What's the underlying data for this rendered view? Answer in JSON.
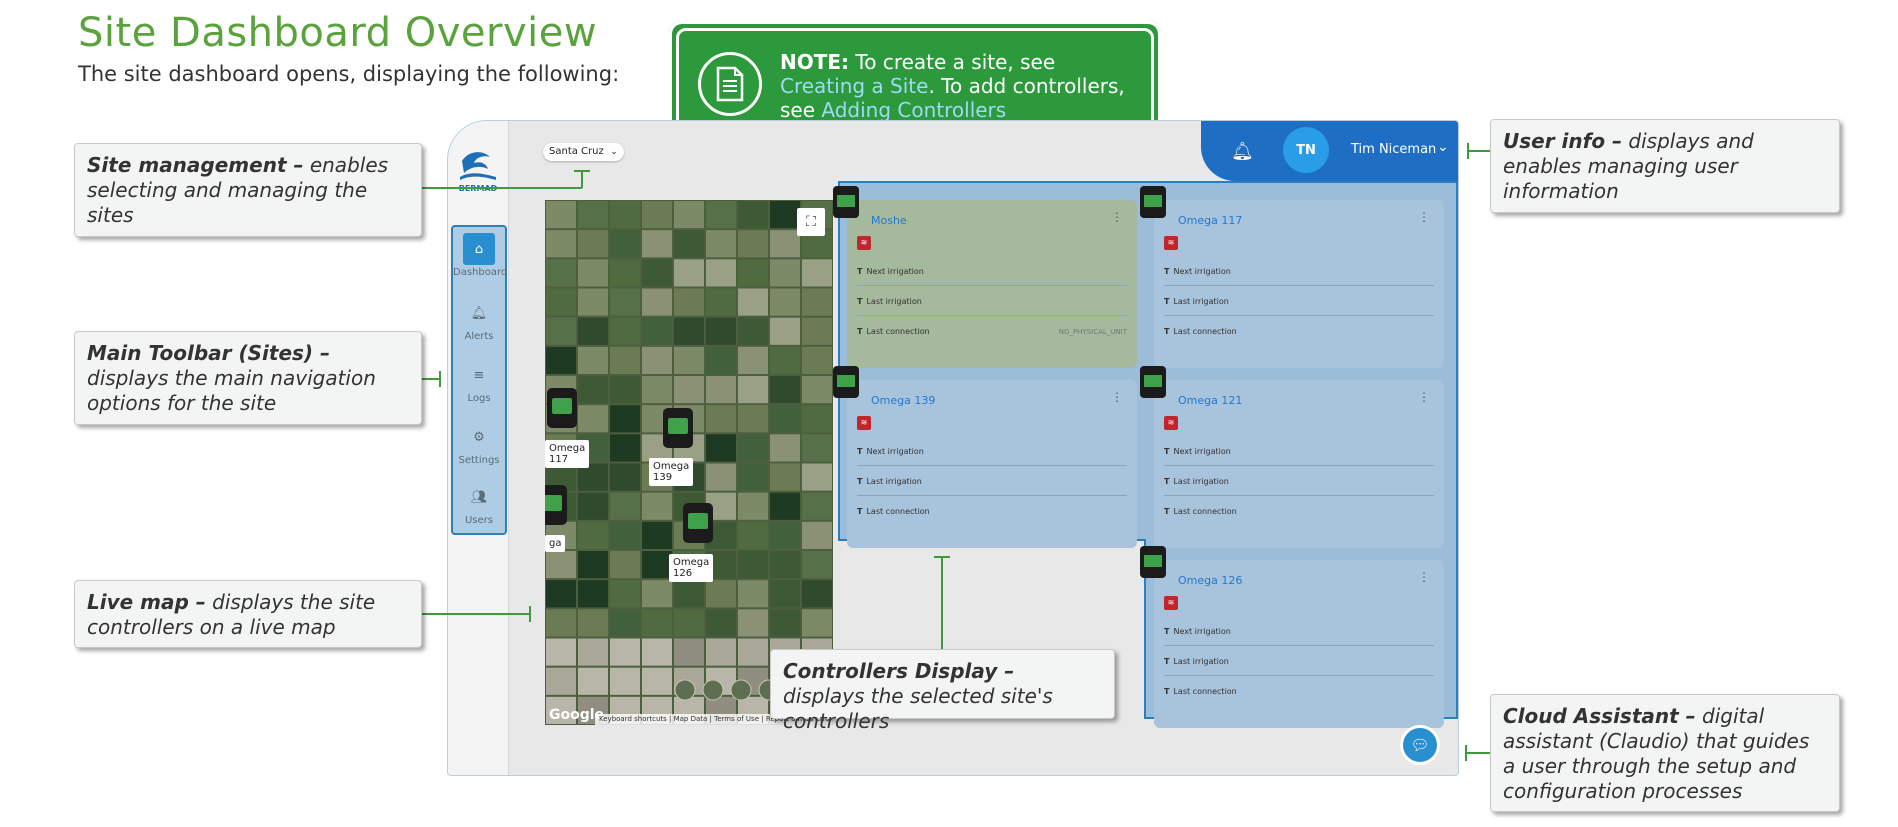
{
  "header": {
    "title": "Site Dashboard Overview",
    "subtitle": "The site dashboard opens, displaying the following:"
  },
  "note": {
    "label": "NOTE:",
    "text1": "To create a site, see",
    "link1": "Creating a Site",
    "text2": ". To add controllers, see",
    "link2": "Adding Controllers",
    "icon": "document-icon"
  },
  "app": {
    "logo_text": "BERMAD",
    "site_selector": "Santa Cruz",
    "user": {
      "initials": "TN",
      "name": "Tim Niceman"
    },
    "toolbar": [
      {
        "label": "Dashboard",
        "icon": "home-icon",
        "active": true
      },
      {
        "label": "Alerts",
        "icon": "bell-icon",
        "active": false
      },
      {
        "label": "Logs",
        "icon": "list-icon",
        "active": false
      },
      {
        "label": "Settings",
        "icon": "gear-icon",
        "active": false
      },
      {
        "label": "Users",
        "icon": "users-icon",
        "active": false
      }
    ],
    "map": {
      "pins": [
        {
          "label_line1": "Omega",
          "label_line2": "117"
        },
        {
          "label_line1": "Omega",
          "label_line2": "139"
        },
        {
          "label_line1": "ga",
          "label_line2": ""
        },
        {
          "label_line1": "Omega",
          "label_line2": "126"
        }
      ],
      "attribution": "Google",
      "footer": "Keyboard shortcuts | Map Data | Terms of Use | Report a map error"
    },
    "controllers": [
      {
        "name": "Moshe",
        "next": "Next irrigation",
        "last": "Last irrigation",
        "conn": "Last connection",
        "conn_value": "NO_PHYSICAL_UNIT"
      },
      {
        "name": "Omega 117",
        "next": "Next irrigation",
        "last": "Last irrigation",
        "conn": "Last connection",
        "conn_value": ""
      },
      {
        "name": "Omega 139",
        "next": "Next irrigation",
        "last": "Last irrigation",
        "conn": "Last connection",
        "conn_value": ""
      },
      {
        "name": "Omega 121",
        "next": "Next irrigation",
        "last": "Last irrigation",
        "conn": "Last connection",
        "conn_value": ""
      },
      {
        "name": "Omega 126",
        "next": "Next irrigation",
        "last": "Last irrigation",
        "conn": "Last connection",
        "conn_value": ""
      }
    ]
  },
  "callouts": {
    "site_management": {
      "title": "Site management –",
      "text": "enables selecting and managing the sites"
    },
    "main_toolbar": {
      "title": "Main Toolbar (Sites) –",
      "text": "displays the main navigation options for the site"
    },
    "live_map": {
      "title": "Live map –",
      "text": "displays the site controllers on a live map"
    },
    "controllers_display": {
      "title": "Controllers Display –",
      "text": "displays the selected site's controllers"
    },
    "user_info": {
      "title": "User info –",
      "text": "displays and enables managing user information"
    },
    "cloud_assistant": {
      "title": "Cloud Assistant –",
      "text": "digital assistant (Claudio) that guides a user through the setup and configuration processes"
    }
  },
  "colors": {
    "title_green": "#5aa33c",
    "note_green": "#2c9a3c",
    "callout_line": "#3f9a3d",
    "user_bar": "#1e6fc4",
    "controller_region": "#9cbdd9"
  }
}
